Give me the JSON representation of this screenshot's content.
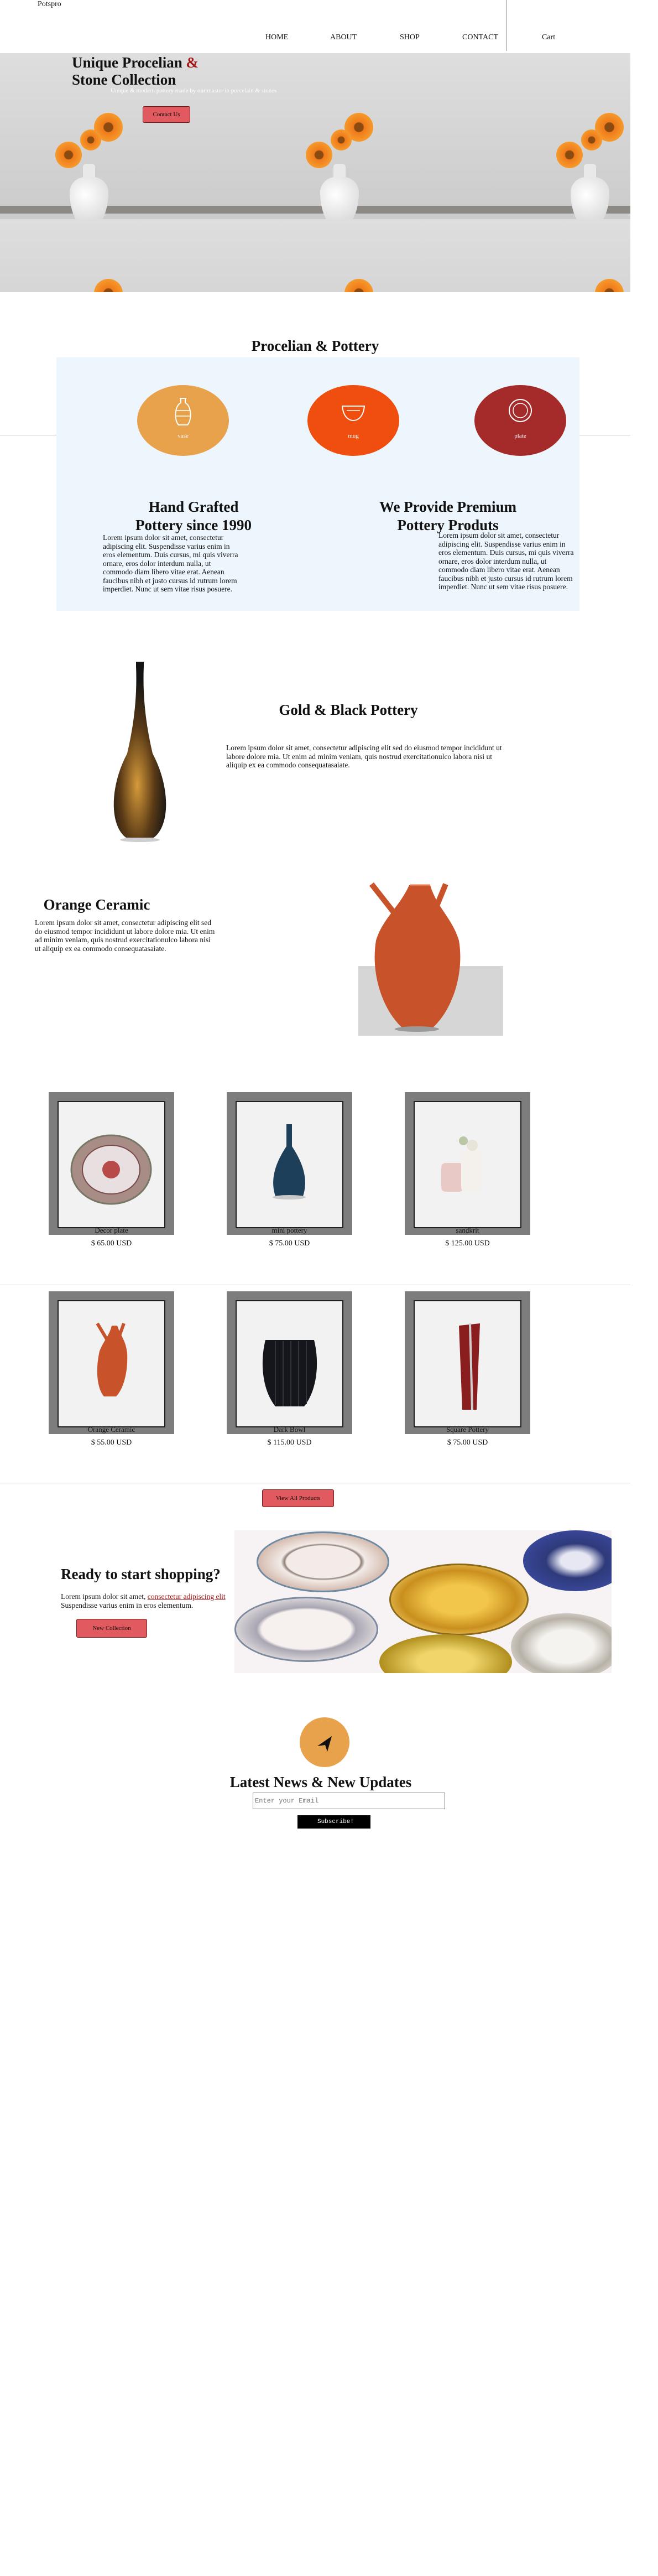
{
  "header": {
    "brand": "Potspro",
    "nav": [
      "HOME",
      "ABOUT",
      "SHOP",
      "CONTACT"
    ],
    "cart": "Cart"
  },
  "hero": {
    "title_line1": "Unique Procelian",
    "title_amp": "&",
    "title_line2": "Stone Collection",
    "subtitle": "Unique & modern pottery made by our master in porcelain & stones",
    "button": "Contact Us"
  },
  "categories": {
    "title": "Procelian & Pottery",
    "items": [
      {
        "label": "vase",
        "color": "#e8a24b",
        "icon": "vase-icon"
      },
      {
        "label": "mug",
        "color": "#f04e0e",
        "icon": "bowl-icon"
      },
      {
        "label": "plate",
        "color": "#a52a2a",
        "icon": "plate-icon"
      }
    ]
  },
  "about": {
    "left_title_1": "Hand Grafted",
    "left_title_2": "Pottery since 1990",
    "left_text": "Lorem ipsum dolor sit amet, consectetur adipiscing elit. Suspendisse varius enim in eros elementum. Duis cursus, mi quis viverra ornare, eros dolor interdum nulla, ut commodo diam libero vitae erat. Aenean faucibus nibh et justo cursus id rutrum lorem imperdiet. Nunc ut sem vitae risus posuere.",
    "right_title_1": "We Provide Premium",
    "right_title_2": "Pottery Produts",
    "right_text": "Lorem ipsum dolor sit amet, consectetur adipiscing elit. Suspendisse varius enim in eros elementum. Duis cursus, mi quis viverra ornare, eros dolor interdum nulla, ut commodo diam libero vitae erat. Aenean faucibus nibh et justo cursus id rutrum lorem imperdiet. Nunc ut sem vitae risus posuere."
  },
  "feature_gold": {
    "title": "Gold & Black Pottery",
    "text": "Lorem ipsum dolor sit amet, consectetur adipiscing elit sed do eiusmod tempor incididunt ut labore dolore mia. Ut enim ad minim veniam, quis nostrud exercitationulco labora nisi ut aliquip ex ea commodo consequatasaiate."
  },
  "feature_orange": {
    "title": "Orange Ceramic",
    "text": "Lorem ipsum dolor sit amet, consectetur adipiscing elit sed do eiusmod tempor incididunt ut labore dolore mia. Ut enim ad minim veniam, quis nostrud exercitationulco labora nisi ut aliquip ex ea commodo consequatasaiate."
  },
  "products": [
    {
      "name": "Decor plate",
      "price": "$ 65.00 USD"
    },
    {
      "name": "mini pottery",
      "price": "$ 75.00 USD"
    },
    {
      "name": "sandkrit",
      "price": "$ 125.00 USD"
    },
    {
      "name": "Orange Ceramic",
      "price": "$ 55.00 USD"
    },
    {
      "name": "Dark Bowl",
      "price": "$ 115.00 USD"
    },
    {
      "name": "Square Pottery",
      "price": "$ 75.00 USD"
    }
  ],
  "view_all": "View All Products",
  "promo": {
    "title": "Ready to start shopping?",
    "text_before": "Lorem ipsum dolor sit amet, ",
    "text_link": "consectetur adipiscing elit",
    "text_after": " Suspendisse varius enim in eros elementum.",
    "button": "New Collection"
  },
  "newsletter": {
    "icon": "send-icon",
    "title": "Latest News & New Updates",
    "placeholder": "Enter your Email",
    "button": "Subscribe!"
  },
  "colors": {
    "accent_red": "#e05a5f",
    "panel_bg": "#eef6fd",
    "card_frame": "#7d7d7d",
    "newsletter_circle": "#e8a24b"
  }
}
